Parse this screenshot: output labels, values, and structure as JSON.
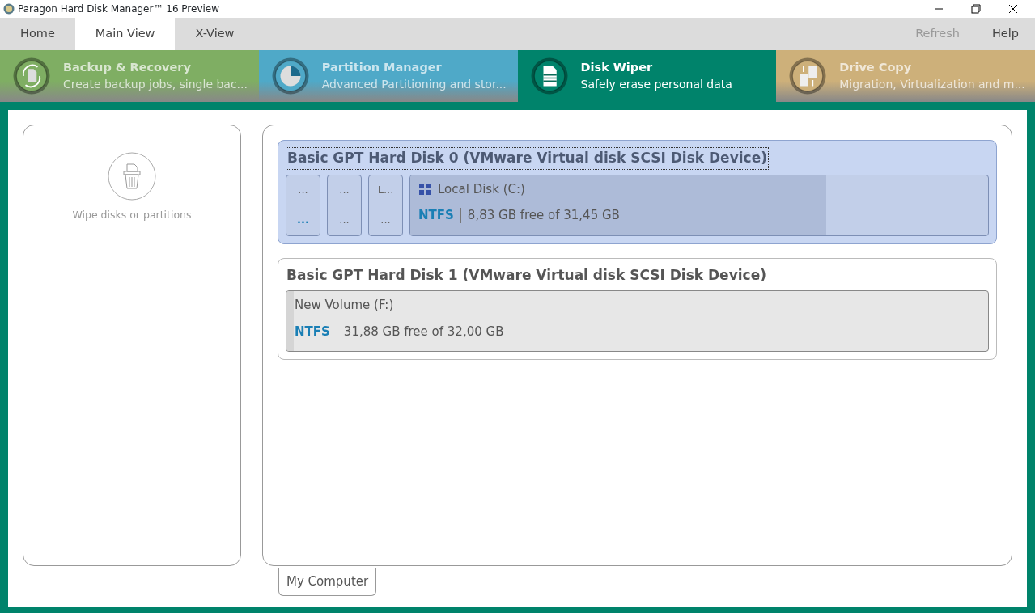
{
  "window": {
    "title": "Paragon Hard Disk Manager™ 16 Preview"
  },
  "menu_tabs": [
    {
      "label": "Home",
      "selected": false
    },
    {
      "label": "Main View",
      "selected": true
    },
    {
      "label": "X-View",
      "selected": false
    }
  ],
  "menu_actions": [
    {
      "label": "Refresh",
      "disabled": true
    },
    {
      "label": "Help",
      "disabled": false
    }
  ],
  "modules": [
    {
      "title": "Backup & Recovery",
      "subtitle": "Create backup jobs, single bac...",
      "color": "#7fae63",
      "selected": false,
      "kind": "backup"
    },
    {
      "title": "Partition Manager",
      "subtitle": "Advanced Partitioning and stor...",
      "color": "#4fa9c8",
      "selected": false,
      "kind": "partition"
    },
    {
      "title": "Disk Wiper",
      "subtitle": "Safely erase personal data",
      "color": "#00836b",
      "selected": true,
      "kind": "wiper"
    },
    {
      "title": "Drive Copy",
      "subtitle": "Migration, Virtualization and m...",
      "color": "#cdb07a",
      "selected": false,
      "kind": "copy"
    }
  ],
  "side_panel": {
    "action": "Wipe disks or partitions"
  },
  "disks": [
    {
      "title": "Basic GPT Hard Disk 0 (VMware Virtual disk SCSI Disk Device)",
      "selected": true,
      "partitions": [
        {
          "kind": "small",
          "name": "...",
          "info": "..."
        },
        {
          "kind": "small",
          "name": "...",
          "info": "..."
        },
        {
          "kind": "small",
          "name": "L...",
          "info": "..."
        },
        {
          "kind": "large",
          "name": "Local Disk (C:)",
          "windows": true,
          "fs": "NTFS",
          "free": "8,83 GB free of 31,45 GB",
          "level": 0.72
        }
      ]
    },
    {
      "title": "Basic GPT Hard Disk 1 (VMware Virtual disk SCSI Disk Device)",
      "selected": false,
      "partitions": [
        {
          "kind": "large",
          "name": "New Volume (F:)",
          "windows": false,
          "fs": "NTFS",
          "free": "31,88 GB free of 32,00 GB",
          "level": 0.01
        }
      ]
    }
  ],
  "bottom_tab": "My Computer"
}
